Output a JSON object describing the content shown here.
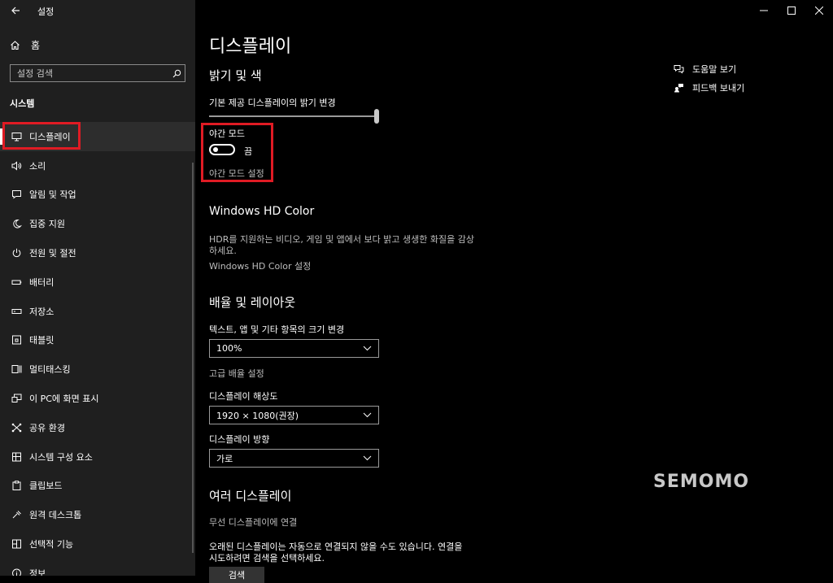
{
  "window": {
    "app_title": "설정",
    "controls": [
      "minimize",
      "maximize",
      "close"
    ]
  },
  "sidebar": {
    "home_label": "홈",
    "search_placeholder": "설정 검색",
    "section_label": "시스템",
    "items": [
      {
        "label": "디스플레이",
        "icon": "monitor-icon"
      },
      {
        "label": "소리",
        "icon": "speaker-icon"
      },
      {
        "label": "알림 및 작업",
        "icon": "notification-icon"
      },
      {
        "label": "집중 지원",
        "icon": "moon-icon"
      },
      {
        "label": "전원 및 절전",
        "icon": "power-icon"
      },
      {
        "label": "배터리",
        "icon": "battery-icon"
      },
      {
        "label": "저장소",
        "icon": "storage-icon"
      },
      {
        "label": "태블릿",
        "icon": "tablet-icon"
      },
      {
        "label": "멀티태스킹",
        "icon": "multitask-icon"
      },
      {
        "label": "이 PC에 화면 표시",
        "icon": "project-icon"
      },
      {
        "label": "공유 환경",
        "icon": "share-icon"
      },
      {
        "label": "시스템 구성 요소",
        "icon": "components-icon"
      },
      {
        "label": "클립보드",
        "icon": "clipboard-icon"
      },
      {
        "label": "원격 데스크톱",
        "icon": "remote-icon"
      },
      {
        "label": "선택적 기능",
        "icon": "features-icon"
      },
      {
        "label": "정보",
        "icon": "info-icon"
      }
    ]
  },
  "main": {
    "title": "디스플레이",
    "brightness": {
      "heading": "밝기 및 색",
      "label": "기본 제공 디스플레이의 밝기 변경",
      "value": 100
    },
    "night_mode": {
      "label": "야간 모드",
      "state": "끔",
      "settings_link": "야간 모드 설정"
    },
    "hd_color": {
      "heading": "Windows HD Color",
      "desc_line1": "HDR를 지원하는 비디오, 게임 및 앱에서 보다 밝고 생생한 화질을 감상",
      "desc_line2": "하세요.",
      "link": "Windows HD Color 설정"
    },
    "scale": {
      "heading": "배율 및 레이아웃",
      "size_label": "텍스트, 앱 및 기타 항목의 크기 변경",
      "size_value": "100%",
      "advanced_link": "고급 배율 설정",
      "resolution_label": "디스플레이 해상도",
      "resolution_value": "1920 × 1080(권장)",
      "orientation_label": "디스플레이 방향",
      "orientation_value": "가로"
    },
    "multi": {
      "heading": "여러 디스플레이",
      "wireless_link": "무선 디스플레이에 연결",
      "desc_line1": "오래된 디스플레이는 자동으로 연결되지 않을 수도 있습니다. 연결을",
      "desc_line2": "시도하려면 검색을 선택하세요.",
      "detect_button": "검색"
    },
    "help_link": "도움말 보기",
    "feedback_link": "피드백 보내기"
  },
  "watermark": "SEMOMO",
  "colors": {
    "highlight": "#e01b24",
    "sidebar_bg": "#1f1f1f",
    "main_bg": "#000000"
  }
}
